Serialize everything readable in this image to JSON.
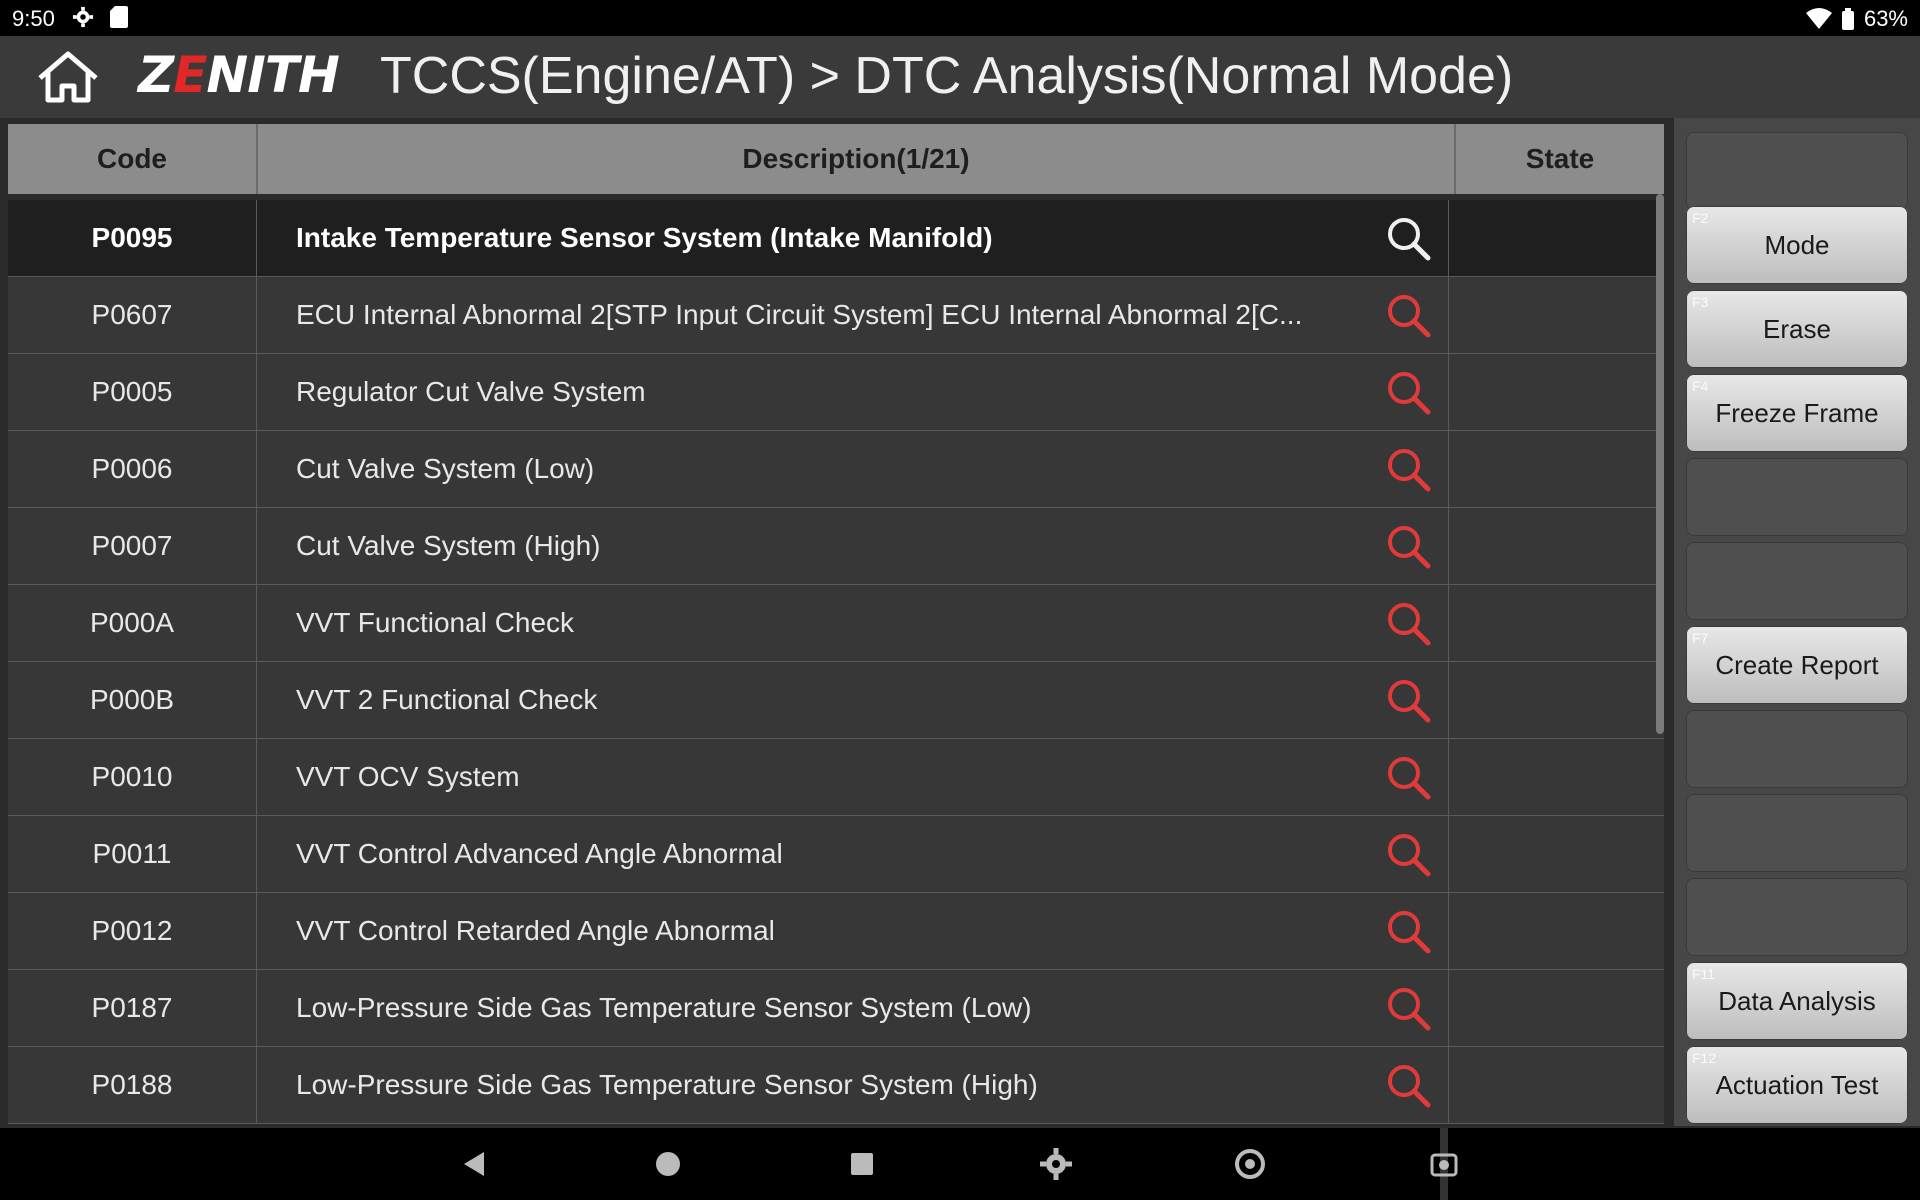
{
  "status": {
    "time": "9:50",
    "battery": "63%"
  },
  "header": {
    "logo_pre": "Z",
    "logo_mid": "E",
    "logo_post": "NITH",
    "title": "TCCS(Engine/AT) > DTC Analysis(Normal Mode)"
  },
  "table": {
    "headers": {
      "code": "Code",
      "description": "Description(1/21)",
      "state": "State"
    },
    "rows": [
      {
        "code": "P0095",
        "description": "Intake Temperature Sensor System (Intake Manifold)",
        "state": ""
      },
      {
        "code": "P0607",
        "description": "ECU Internal Abnormal 2[STP Input Circuit System] ECU Internal Abnormal 2[C...",
        "state": ""
      },
      {
        "code": "P0005",
        "description": "Regulator Cut Valve System",
        "state": ""
      },
      {
        "code": "P0006",
        "description": "Cut Valve System (Low)",
        "state": ""
      },
      {
        "code": "P0007",
        "description": "Cut Valve System (High)",
        "state": ""
      },
      {
        "code": "P000A",
        "description": "VVT Functional Check",
        "state": ""
      },
      {
        "code": "P000B",
        "description": "VVT 2 Functional Check",
        "state": ""
      },
      {
        "code": "P0010",
        "description": "VVT OCV System",
        "state": ""
      },
      {
        "code": "P0011",
        "description": "VVT Control Advanced Angle Abnormal",
        "state": ""
      },
      {
        "code": "P0012",
        "description": "VVT Control Retarded Angle Abnormal",
        "state": ""
      },
      {
        "code": "P0187",
        "description": "Low-Pressure Side Gas Temperature Sensor System (Low)",
        "state": ""
      },
      {
        "code": "P0188",
        "description": "Low-Pressure Side Gas Temperature Sensor System (High)",
        "state": ""
      }
    ]
  },
  "function_keys": [
    {
      "key": "",
      "label": ""
    },
    {
      "key": "F2",
      "label": "Mode"
    },
    {
      "key": "F3",
      "label": "Erase"
    },
    {
      "key": "F4",
      "label": "Freeze Frame"
    },
    {
      "key": "",
      "label": ""
    },
    {
      "key": "",
      "label": ""
    },
    {
      "key": "F7",
      "label": "Create Report"
    },
    {
      "key": "",
      "label": ""
    },
    {
      "key": "",
      "label": ""
    },
    {
      "key": "",
      "label": ""
    },
    {
      "key": "F11",
      "label": "Data Analysis"
    },
    {
      "key": "F12",
      "label": "Actuation Test"
    }
  ],
  "colors": {
    "accent": "#e03a3a",
    "selected_row": "#1f1f1f",
    "row": "#373737",
    "header": "#8c8c8c"
  },
  "icons": [
    "home-icon",
    "search-icon",
    "back-icon",
    "home-circle-icon",
    "recents-icon",
    "settings-icon",
    "chrome-icon",
    "screenshot-icon"
  ]
}
